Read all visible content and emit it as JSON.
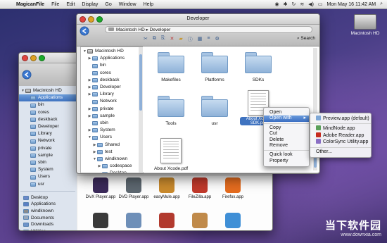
{
  "menubar": {
    "app_name": "MagicanFile",
    "items": [
      "File",
      "Edit",
      "Display",
      "Go",
      "Window",
      "Help"
    ],
    "clock": "Mon May 16  11:42 AM"
  },
  "desktop": {
    "hd_label": "Macintosh HD"
  },
  "front_window": {
    "title": "Developer",
    "path": [
      "Macintosh HD",
      "Developer"
    ],
    "search_label": "Search",
    "tree": [
      {
        "label": "Macintosh HD",
        "indent": 0,
        "open": true
      },
      {
        "label": "Applications",
        "indent": 1,
        "open": false
      },
      {
        "label": "bin",
        "indent": 1
      },
      {
        "label": "cores",
        "indent": 1
      },
      {
        "label": "deskback",
        "indent": 1,
        "open": false
      },
      {
        "label": "Developer",
        "indent": 1,
        "open": false
      },
      {
        "label": "Library",
        "indent": 1,
        "open": false
      },
      {
        "label": "Network",
        "indent": 1
      },
      {
        "label": "private",
        "indent": 1,
        "open": false
      },
      {
        "label": "sample",
        "indent": 1,
        "open": false
      },
      {
        "label": "sbin",
        "indent": 1
      },
      {
        "label": "System",
        "indent": 1,
        "open": false
      },
      {
        "label": "Users",
        "indent": 1,
        "open": true
      },
      {
        "label": "Shared",
        "indent": 2,
        "open": false
      },
      {
        "label": "test",
        "indent": 2,
        "open": false
      },
      {
        "label": "windknown",
        "indent": 2,
        "open": true
      },
      {
        "label": "codespace",
        "indent": 3,
        "open": false
      },
      {
        "label": "Desktop",
        "indent": 3
      }
    ],
    "items": [
      {
        "label": "Makefiles",
        "kind": "folder"
      },
      {
        "label": "Platforms",
        "kind": "folder"
      },
      {
        "label": "SDKs",
        "kind": "folder"
      },
      {
        "label": "Tools",
        "kind": "folder"
      },
      {
        "label": "usr",
        "kind": "folder"
      },
      {
        "label": "About Xcode.pdf",
        "kind": "doc"
      },
      {
        "label": "About Xcode.pdf",
        "kind": "doc"
      }
    ],
    "selected_item": "About Xcode SDK.pdf"
  },
  "context_menu": {
    "items": [
      "Open",
      "Open with",
      "Copy",
      "Cut",
      "Delete",
      "Remove",
      "Quick look",
      "Property"
    ],
    "highlighted": "Open with"
  },
  "submenu": {
    "items": [
      "Preview.app (default)",
      "MindNode.app",
      "Adobe Reader.app",
      "ColorSync Utility.app",
      "Other..."
    ]
  },
  "back_window": {
    "tree": [
      {
        "label": "Macintosh HD",
        "indent": 0,
        "open": true
      },
      {
        "label": "Applications",
        "indent": 1,
        "selected": true
      },
      {
        "label": "bin",
        "indent": 1
      },
      {
        "label": "cores",
        "indent": 1
      },
      {
        "label": "deskback",
        "indent": 1
      },
      {
        "label": "Developer",
        "indent": 1
      },
      {
        "label": "Library",
        "indent": 1
      },
      {
        "label": "Network",
        "indent": 1
      },
      {
        "label": "private",
        "indent": 1
      },
      {
        "label": "sample",
        "indent": 1
      },
      {
        "label": "sbin",
        "indent": 1
      },
      {
        "label": "System",
        "indent": 1
      },
      {
        "label": "Users",
        "indent": 1
      },
      {
        "label": "usr",
        "indent": 1
      }
    ],
    "places": [
      "Desktop",
      "Applications",
      "windknown",
      "Documents",
      "Downloads",
      "Utilities"
    ],
    "apps": [
      {
        "label": "DivX Player.app",
        "color": "#3b2a5a"
      },
      {
        "label": "DVD Player.app",
        "color": "#5d6770"
      },
      {
        "label": "easyMule.app",
        "color": "#c98a2d"
      },
      {
        "label": "FileZilla.app",
        "color": "#c0392b"
      },
      {
        "label": "Firefox.app",
        "color": "#e46c1f"
      }
    ],
    "apps_row2_colors": [
      "#3a3a3a",
      "#6e8fb8",
      "#b23a2e",
      "#c08a4a",
      "#3f8fd6"
    ]
  },
  "watermark": {
    "line1": "当下软件园",
    "line2": "www.downxia.com"
  },
  "colors": {
    "selection": "#3f73c0",
    "folder": "#8fb2d8"
  }
}
